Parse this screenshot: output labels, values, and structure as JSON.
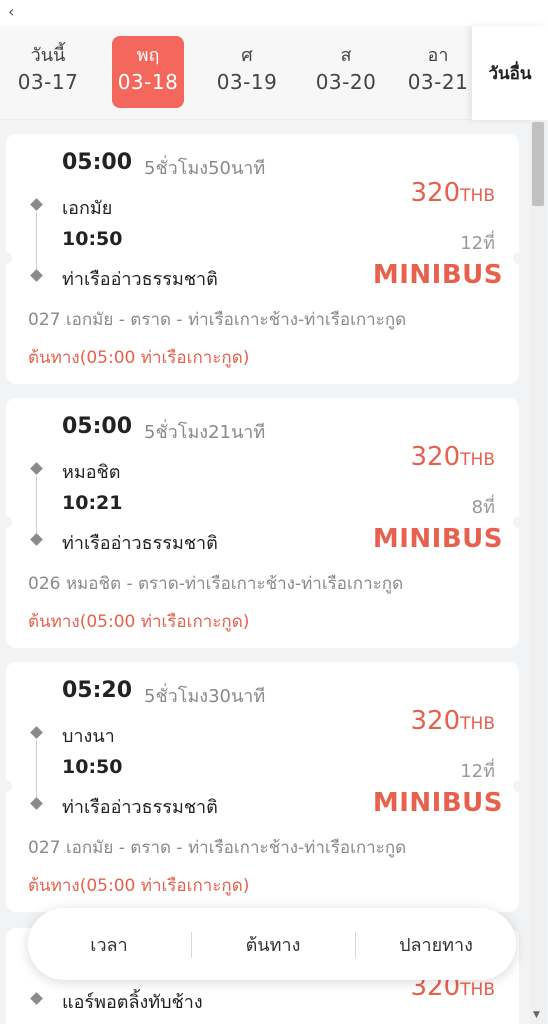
{
  "nav": {
    "back_glyph": "‹"
  },
  "date_tabs": [
    {
      "day": "วันนี้",
      "date": "03-17",
      "active": false
    },
    {
      "day": "พฤ",
      "date": "03-18",
      "active": true
    },
    {
      "day": "ศ",
      "date": "03-19",
      "active": false
    },
    {
      "day": "ส",
      "date": "03-20",
      "active": false
    },
    {
      "day": "อา",
      "date": "03-21",
      "active": false
    }
  ],
  "other_day_label": "วันอื่น",
  "trips": [
    {
      "dep_time": "05:00",
      "duration": "5ชั่วโมง50นาที",
      "origin": "เอกมัย",
      "arr_time": "10:50",
      "dest": "ท่าเรืออ่าวธรรมชาติ",
      "price": "320",
      "currency": "THB",
      "seats": "12ที่",
      "vehicle": "MINIBUS",
      "route": "027 เอกมัย - ตราด - ท่าเรือเกาะช้าง-ท่าเรือเกาะกูด",
      "route_note": "ต้นทาง(05:00 ท่าเรือเกาะกูด)"
    },
    {
      "dep_time": "05:00",
      "duration": "5ชั่วโมง21นาที",
      "origin": "หมอชิต",
      "arr_time": "10:21",
      "dest": "ท่าเรืออ่าวธรรมชาติ",
      "price": "320",
      "currency": "THB",
      "seats": "8ที่",
      "vehicle": "MINIBUS",
      "route": "026 หมอชิต - ตราด-ท่าเรือเกาะช้าง-ท่าเรือเกาะกูด",
      "route_note": "ต้นทาง(05:00 ท่าเรือเกาะกูด)"
    },
    {
      "dep_time": "05:20",
      "duration": "5ชั่วโมง30นาที",
      "origin": "บางนา",
      "arr_time": "10:50",
      "dest": "ท่าเรืออ่าวธรรมชาติ",
      "price": "320",
      "currency": "THB",
      "seats": "12ที่",
      "vehicle": "MINIBUS",
      "route": "027 เอกมัย - ตราด - ท่าเรือเกาะช้าง-ท่าเรือเกาะกูด",
      "route_note": "ต้นทาง(05:00 ท่าเรือเกาะกูด)"
    },
    {
      "origin": "แอร์พอตลิ้งทับช้าง",
      "price": "320",
      "currency": "THB"
    }
  ],
  "sort": {
    "time": "เวลา",
    "origin": "ต้นทาง",
    "dest": "ปลายทาง"
  },
  "colors": {
    "accent": "#f4675c",
    "price": "#e8614f"
  }
}
